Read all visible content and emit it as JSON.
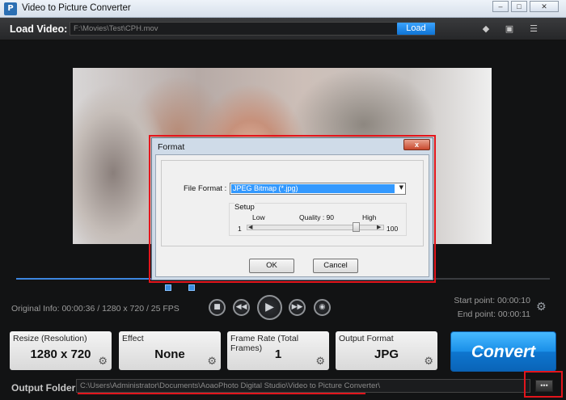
{
  "window": {
    "title": "Video to Picture Converter",
    "controls": [
      "minimize-icon",
      "maximize-icon",
      "close-icon"
    ]
  },
  "load_bar": {
    "label": "Load Video:",
    "path_value": "F:\\Movies\\Test\\CPH.mov",
    "load_button": "Load",
    "icons": [
      "tag-icon",
      "comment-icon",
      "document-list-icon"
    ]
  },
  "playback": {
    "original_info": "Original Info: 00:00:36 / 1280 x 720 / 25 FPS",
    "start_point": "Start point: 00:00:10",
    "end_point": "End point: 00:00:11",
    "controls": [
      "stop-icon",
      "rewind-icon",
      "play-icon",
      "fast-forward-icon",
      "camera-icon"
    ]
  },
  "panels": [
    {
      "title": "Resize (Resolution)",
      "value": "1280 x 720"
    },
    {
      "title": "Effect",
      "value": "None"
    },
    {
      "title": "Frame Rate (Total Frames)",
      "value": "1"
    },
    {
      "title": "Output Format",
      "value": "JPG"
    }
  ],
  "convert_button": "Convert",
  "output": {
    "label": "Output Folder:",
    "path_value": "C:\\Users\\Administrator\\Documents\\AoaoPhoto Digital Studio\\Video to Picture Converter\\",
    "browse_label": "•••"
  },
  "dialog": {
    "title": "Format",
    "close_label": "x",
    "file_format_label": "File Format :",
    "file_format_value": "JPEG Bitmap (*.jpg)",
    "setup_label": "Setup",
    "low_label": "Low",
    "quality_label": "Quality : 90",
    "high_label": "High",
    "min_value": "1",
    "max_value": "100",
    "quality": 90,
    "ok_button": "OK",
    "cancel_button": "Cancel"
  },
  "colors": {
    "accent_blue": "#1a8fe8",
    "highlight_red": "#e3151c",
    "selection_blue": "#3399ff"
  }
}
